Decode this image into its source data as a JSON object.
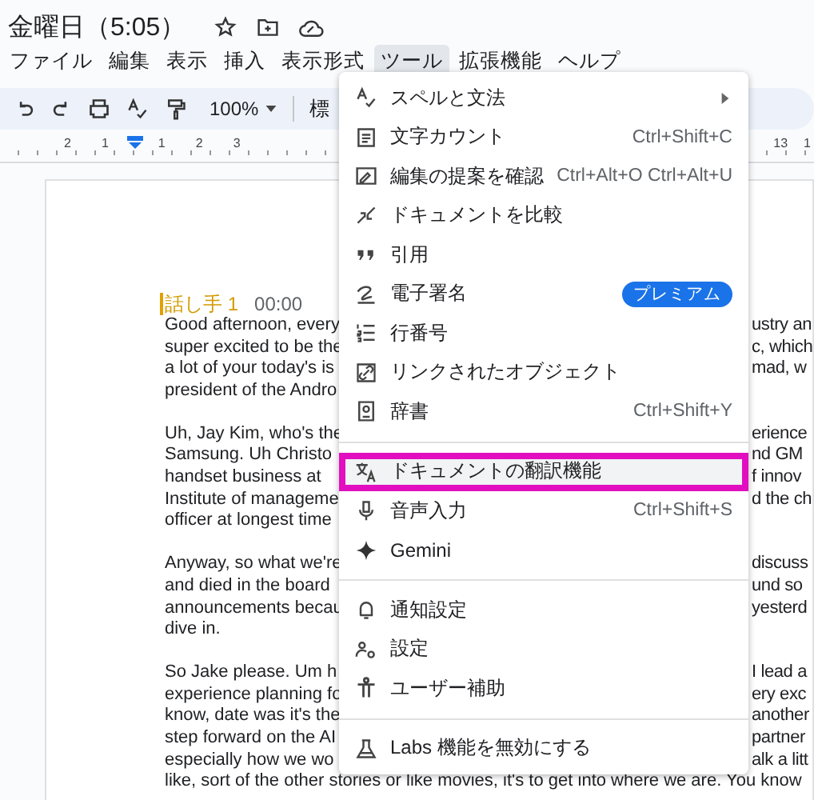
{
  "document_title": "金曜日（5:05）",
  "menu_bar": [
    {
      "label": "ファイル",
      "selected": false
    },
    {
      "label": "編集",
      "selected": false
    },
    {
      "label": "表示",
      "selected": false
    },
    {
      "label": "挿入",
      "selected": false
    },
    {
      "label": "表示形式",
      "selected": false
    },
    {
      "label": "ツール",
      "selected": true
    },
    {
      "label": "拡張機能",
      "selected": false
    },
    {
      "label": "ヘルプ",
      "selected": false
    }
  ],
  "toolbar": {
    "zoom": "100%",
    "style_field": "標"
  },
  "ruler": {
    "left_numbers": [
      "2",
      "1",
      "1",
      "2",
      "3"
    ],
    "right_numbers": [
      "13",
      "1"
    ]
  },
  "document": {
    "speaker": "話し手 1",
    "timestamp": "00:00",
    "paragraphs": [
      [
        {
          "left": "Good afternoon, every",
          "right": "ustry an"
        },
        {
          "left": "super excited to be the",
          "right": "c, which"
        },
        {
          "left": "a lot of your today's is",
          "right": "mad, w"
        },
        {
          "left": "president of the Andro"
        }
      ],
      [
        {
          "left": "Uh, Jay Kim, who's the",
          "right": "erience"
        },
        {
          "left": "Samsung. Uh Christo",
          "right": "nd GM"
        },
        {
          "left": "handset business at",
          "right": "f innov"
        },
        {
          "left": "Institute of manageme",
          "right": "d the ch"
        },
        {
          "left": "officer at longest time"
        }
      ],
      [
        {
          "left": "Anyway, so what we're",
          "right": "discuss"
        },
        {
          "left": "and died in the board",
          "right": "und so"
        },
        {
          "left": "announcements becau",
          "right": "yesterd"
        },
        {
          "left": "dive in."
        }
      ],
      [
        {
          "left": "So Jake please. Um h",
          "right": "I lead a"
        },
        {
          "left": "experience planning fo",
          "right": "ery exc"
        },
        {
          "left": "know, date was it's the",
          "right": "another"
        },
        {
          "left": "step forward on the AI",
          "right": "partner"
        },
        {
          "left": "especially how we wo",
          "right": "alk a litt"
        },
        {
          "left": "like, sort of the other stories or like movies, it's to get into where we are. You know"
        }
      ]
    ]
  },
  "tools_menu": {
    "groups": [
      [
        {
          "label": "スペルと文法",
          "kind": "submenu",
          "highlighted": false
        },
        {
          "label": "文字カウント",
          "kind": "shortcut",
          "shortcut": "Ctrl+Shift+C",
          "highlighted": false
        },
        {
          "label": "編集の提案を確認",
          "kind": "shortcut",
          "shortcut": "Ctrl+Alt+O Ctrl+Alt+U",
          "highlighted": false
        },
        {
          "label": "ドキュメントを比較",
          "kind": "plain",
          "highlighted": false
        },
        {
          "label": "引用",
          "kind": "plain",
          "highlighted": false
        },
        {
          "label": "電子署名",
          "kind": "badge",
          "badge": "プレミアム",
          "highlighted": false
        },
        {
          "label": "行番号",
          "kind": "plain",
          "highlighted": false
        },
        {
          "label": "リンクされたオブジェクト",
          "kind": "plain",
          "highlighted": false
        },
        {
          "label": "辞書",
          "kind": "shortcut",
          "shortcut": "Ctrl+Shift+Y",
          "highlighted": false
        }
      ],
      [
        {
          "label": "ドキュメントの翻訳機能",
          "kind": "plain",
          "highlighted": true
        },
        {
          "label": "音声入力",
          "kind": "shortcut",
          "shortcut": "Ctrl+Shift+S",
          "highlighted": false
        },
        {
          "label": "Gemini",
          "kind": "plain",
          "highlighted": false
        }
      ],
      [
        {
          "label": "通知設定",
          "kind": "plain",
          "highlighted": false
        },
        {
          "label": "設定",
          "kind": "plain",
          "highlighted": false
        },
        {
          "label": "ユーザー補助",
          "kind": "plain",
          "highlighted": false
        }
      ],
      [
        {
          "label": "Labs 機能を無効にする",
          "kind": "plain",
          "highlighted": false
        }
      ]
    ]
  }
}
